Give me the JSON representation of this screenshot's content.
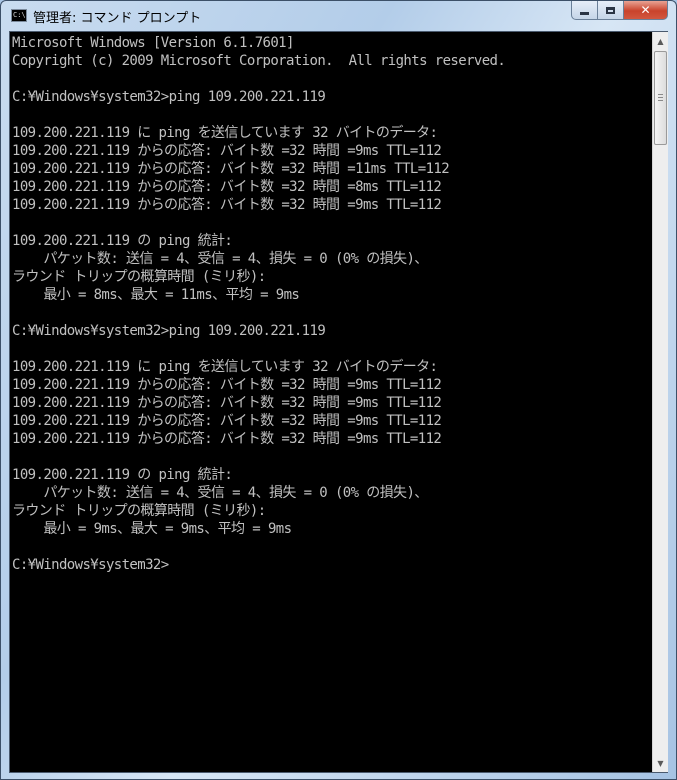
{
  "window": {
    "title": "管理者: コマンド プロンプト",
    "icon_name": "cmd-app-icon",
    "icon_text": "C:\\",
    "close_glyph": "✕"
  },
  "scrollbar": {
    "up_glyph": "▲",
    "down_glyph": "▼"
  },
  "colors": {
    "console_background": "#000000",
    "console_text": "#c0c0c0",
    "close_button": "#c9432c"
  },
  "console": {
    "lines": [
      "Microsoft Windows [Version 6.1.7601]",
      "Copyright (c) 2009 Microsoft Corporation.  All rights reserved.",
      "",
      "C:¥Windows¥system32>ping 109.200.221.119",
      "",
      "109.200.221.119 に ping を送信しています 32 バイトのデータ:",
      "109.200.221.119 からの応答: バイト数 =32 時間 =9ms TTL=112",
      "109.200.221.119 からの応答: バイト数 =32 時間 =11ms TTL=112",
      "109.200.221.119 からの応答: バイト数 =32 時間 =8ms TTL=112",
      "109.200.221.119 からの応答: バイト数 =32 時間 =9ms TTL=112",
      "",
      "109.200.221.119 の ping 統計:",
      "    パケット数: 送信 = 4、受信 = 4、損失 = 0 (0% の損失)、",
      "ラウンド トリップの概算時間 (ミリ秒):",
      "    最小 = 8ms、最大 = 11ms、平均 = 9ms",
      "",
      "C:¥Windows¥system32>ping 109.200.221.119",
      "",
      "109.200.221.119 に ping を送信しています 32 バイトのデータ:",
      "109.200.221.119 からの応答: バイト数 =32 時間 =9ms TTL=112",
      "109.200.221.119 からの応答: バイト数 =32 時間 =9ms TTL=112",
      "109.200.221.119 からの応答: バイト数 =32 時間 =9ms TTL=112",
      "109.200.221.119 からの応答: バイト数 =32 時間 =9ms TTL=112",
      "",
      "109.200.221.119 の ping 統計:",
      "    パケット数: 送信 = 4、受信 = 4、損失 = 0 (0% の損失)、",
      "ラウンド トリップの概算時間 (ミリ秒):",
      "    最小 = 9ms、最大 = 9ms、平均 = 9ms",
      "",
      "C:¥Windows¥system32>"
    ]
  }
}
